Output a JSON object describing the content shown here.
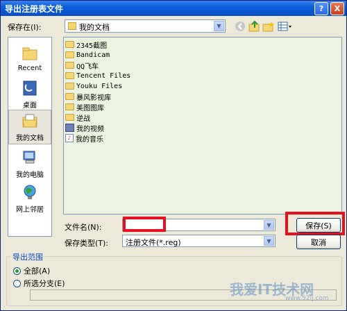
{
  "window": {
    "title": "导出注册表文件",
    "help_glyph": "?",
    "close_glyph": "X"
  },
  "save_in": {
    "label": "保存在(I):",
    "value": "我的文档"
  },
  "places": [
    {
      "label": "Recent",
      "icon": "recent-folder-icon"
    },
    {
      "label": "桌面",
      "icon": "desktop-icon"
    },
    {
      "label": "我的文档",
      "icon": "my-documents-icon",
      "selected": true
    },
    {
      "label": "我的电脑",
      "icon": "my-computer-icon"
    },
    {
      "label": "网上邻居",
      "icon": "network-places-icon"
    }
  ],
  "files": [
    {
      "name": "2345截图",
      "icon": "folder-icon"
    },
    {
      "name": "Bandicam",
      "icon": "folder-icon"
    },
    {
      "name": "QQ飞车",
      "icon": "folder-icon"
    },
    {
      "name": "Tencent Files",
      "icon": "folder-icon"
    },
    {
      "name": "Youku Files",
      "icon": "folder-icon"
    },
    {
      "name": "暴风影视库",
      "icon": "folder-icon"
    },
    {
      "name": "美图图库",
      "icon": "folder-icon"
    },
    {
      "name": "逆战",
      "icon": "folder-icon"
    },
    {
      "name": "我的视频",
      "icon": "media-folder-icon"
    },
    {
      "name": "我的音乐",
      "icon": "music-folder-icon"
    }
  ],
  "filename": {
    "label": "文件名(N):",
    "value": ""
  },
  "filetype": {
    "label": "保存类型(T):",
    "value": "注册文件(*.reg)"
  },
  "buttons": {
    "save": "保存(S)",
    "cancel": "取消"
  },
  "export_range": {
    "title": "导出范围",
    "all_label": "全部(A)",
    "branch_label": "所选分支(E)",
    "selected": "all",
    "branch_value": ""
  },
  "watermark": {
    "text": "我爱IT技术网",
    "sub": "www.52ij.com"
  },
  "colors": {
    "titlebar": "#0a5fd8",
    "highlight_box": "#e8101c",
    "list_bg": "#ecf3e0",
    "group_title": "#0046d5"
  }
}
